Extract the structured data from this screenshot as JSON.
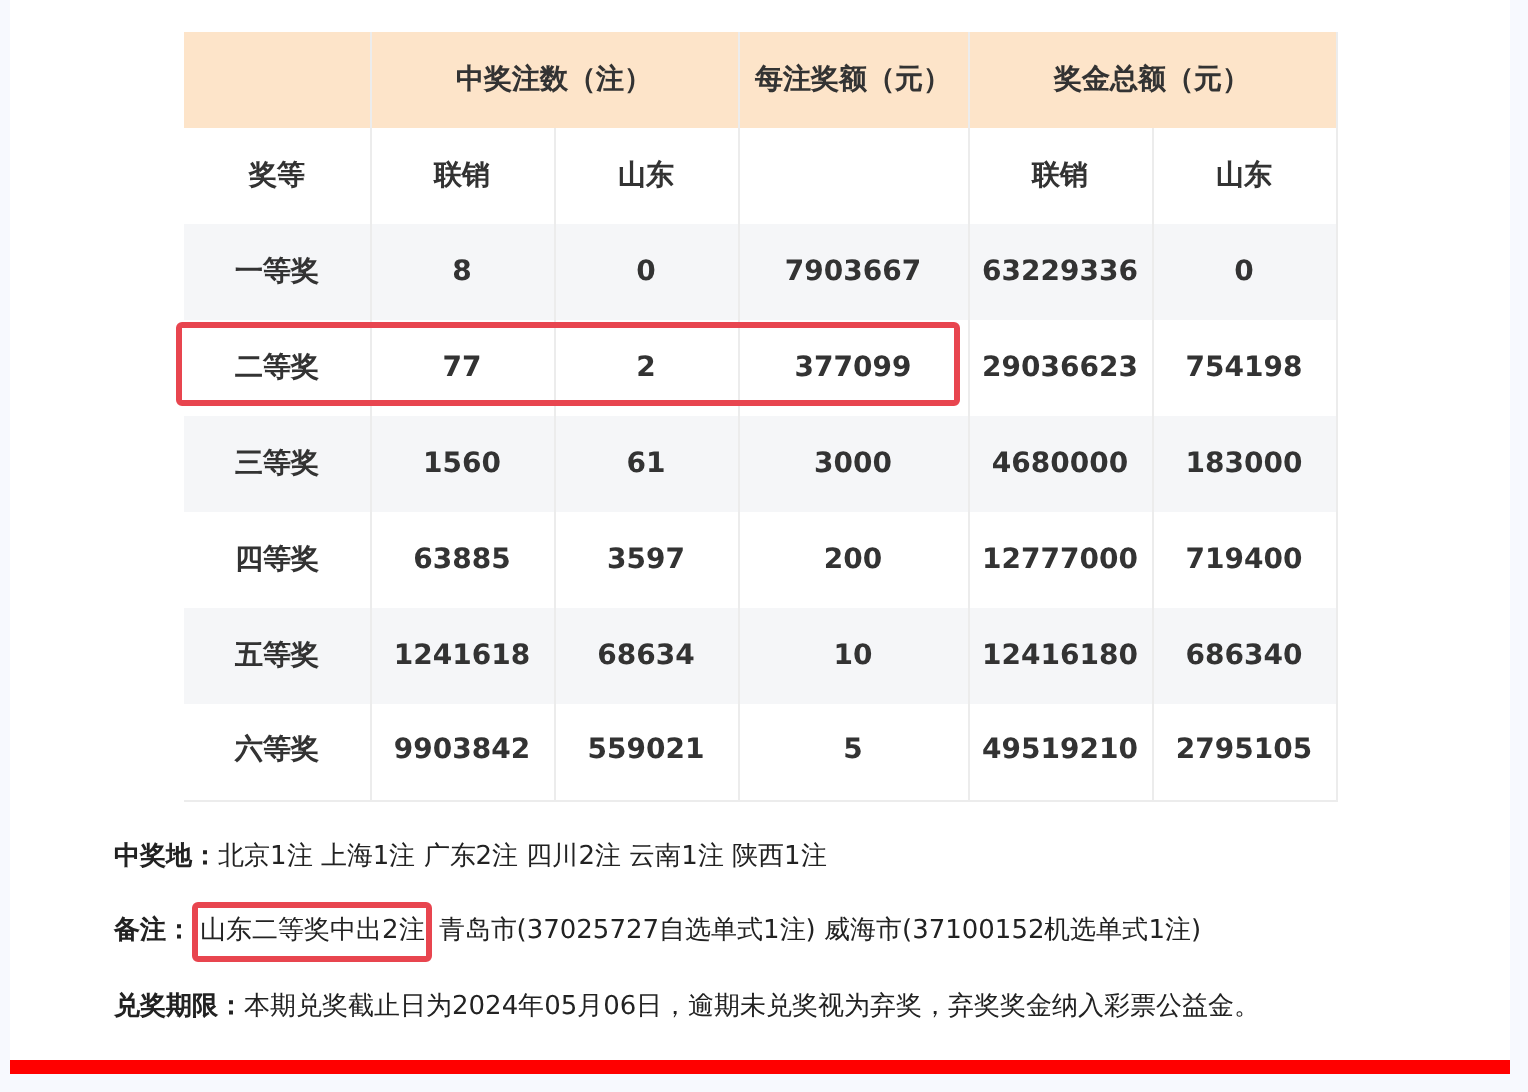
{
  "table": {
    "group_headers": [
      "中奖注数（注）",
      "每注奖额（元）",
      "奖金总额（元）"
    ],
    "columns": [
      "奖等",
      "联销",
      "山东",
      "",
      "联销",
      "山东"
    ],
    "rows": [
      {
        "cells": [
          "一等奖",
          "8",
          "0",
          "7903667",
          "63229336",
          "0"
        ],
        "highlighted": false
      },
      {
        "cells": [
          "二等奖",
          "77",
          "2",
          "377099",
          "29036623",
          "754198"
        ],
        "highlighted": true
      },
      {
        "cells": [
          "三等奖",
          "1560",
          "61",
          "3000",
          "4680000",
          "183000"
        ],
        "highlighted": false
      },
      {
        "cells": [
          "四等奖",
          "63885",
          "3597",
          "200",
          "12777000",
          "719400"
        ],
        "highlighted": false
      },
      {
        "cells": [
          "五等奖",
          "1241618",
          "68634",
          "10",
          "12416180",
          "686340"
        ],
        "highlighted": false
      },
      {
        "cells": [
          "六等奖",
          "9903842",
          "559021",
          "5",
          "49519210",
          "2795105"
        ],
        "highlighted": false
      }
    ]
  },
  "notes": [
    {
      "label": "中奖地：",
      "segments": [
        {
          "text": "北京1注 上海1注 广东2注 四川2注 云南1注 陕西1注",
          "highlighted": false
        }
      ]
    },
    {
      "label": "备注：",
      "segments": [
        {
          "text": "山东二等奖中出2注",
          "highlighted": true
        },
        {
          "text": "青岛市(37025727自选单式1注) 威海市(37100152机选单式1注)",
          "highlighted": false
        }
      ]
    },
    {
      "label": "兑奖期限：",
      "segments": [
        {
          "text": "本期兑奖截止日为2024年05月06日，逾期未兑奖视为弃奖，弃奖奖金纳入彩票公益金。",
          "highlighted": false
        }
      ]
    }
  ]
}
